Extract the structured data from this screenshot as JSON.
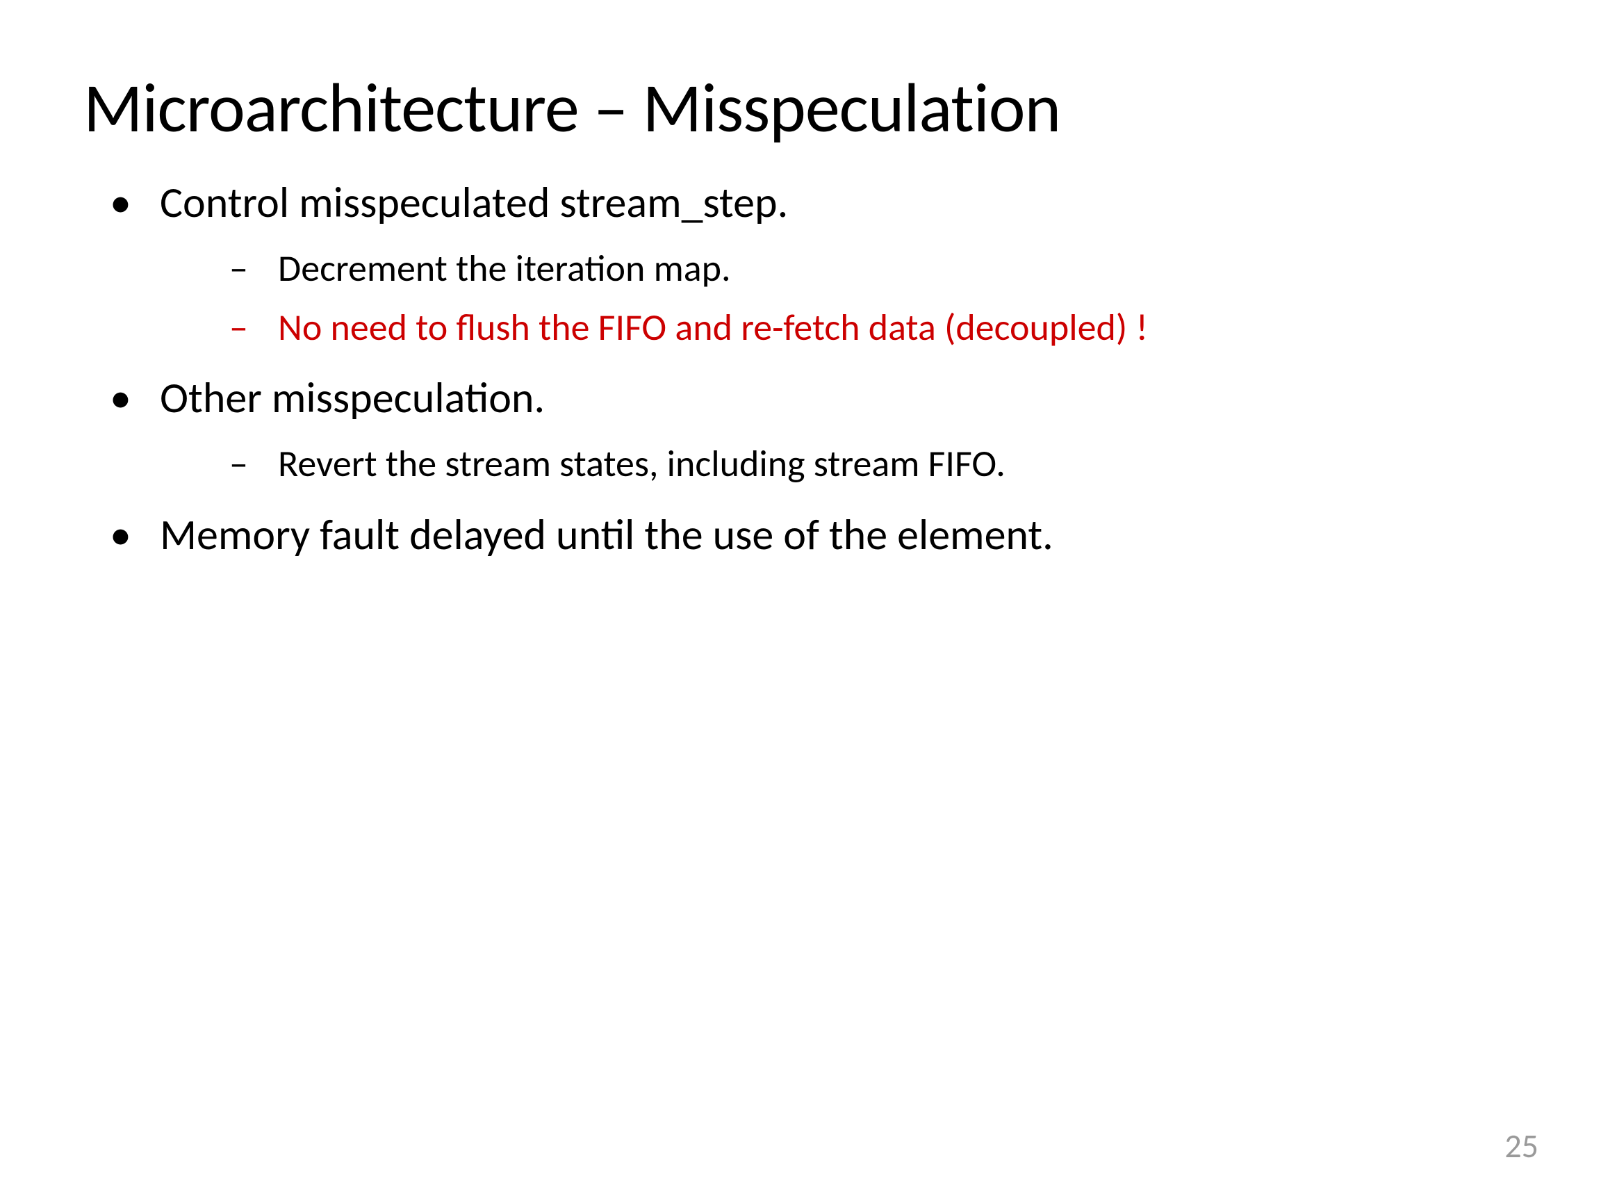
{
  "title": "Microarchitecture – Misspeculation",
  "bullets": [
    {
      "text": "Control misspeculated stream_step.",
      "sub": [
        {
          "text": "Decrement the iteration map.",
          "red": false
        },
        {
          "text": "No need to flush the FIFO and re-fetch data (decoupled) !",
          "red": true
        }
      ]
    },
    {
      "text": "Other misspeculation.",
      "sub": [
        {
          "text": "Revert the stream states, including stream FIFO.",
          "red": false
        }
      ]
    },
    {
      "text": "Memory fault delayed until the use of the element.",
      "sub": []
    }
  ],
  "page_number": "25"
}
